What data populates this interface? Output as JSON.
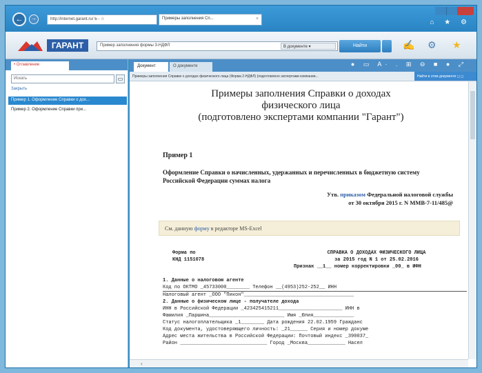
{
  "browser": {
    "back_icon": "back-arrow-icon",
    "address": "http://internet.garant.ru/ ᑲ - ☆",
    "tab_title": "Примеры заполнения Сп...",
    "tab_close": "×",
    "toolbar_icons": "⌂ ★ ⚙"
  },
  "garant": {
    "logo_text": "ГАРАНТ",
    "search_value": "Пример заполнения формы 3-НДФЛ",
    "search_scope": "В документе ▾",
    "find_label": "Найти",
    "icons": [
      "book-icon",
      "settings-icon",
      "star-icon"
    ]
  },
  "left_panel": {
    "tab_label": "• Оглавление",
    "search_placeholder": "Искать",
    "search_btn": "▭",
    "link_label": "Закрыть",
    "items": [
      {
        "label": "Пример 1. Оформление Справки о дох...",
        "selected": true
      },
      {
        "label": "Пример 2. Оформление Справки при...",
        "selected": false
      }
    ]
  },
  "doc": {
    "tab_active": "Документ",
    "tab_inactive": "О документе",
    "tab_icons": "● ▭ A· . ⊞ ⊖ ■ ● ⤢",
    "title_bar": "Примеры заполнения Справки о доходах физического лица (Форма 2-НДФЛ) (подготовлено экспертами компании...",
    "title_bar_right": "Найти в этом документе ◻ ◻",
    "heading_lines": [
      "Примеры заполнения Справки о доходах",
      "физического лица",
      "(подготовлено экспертами компании \"Гарант\")"
    ],
    "example_title": "Пример 1",
    "example_desc": "Оформление Справки о начисленных, удержанных и перечисленных в бюджетную систему Российской Федерации суммах налога",
    "approved_prefix": "Утв.",
    "approved_link": "приказом",
    "approved_rest": "Федеральной налоговой службы",
    "approved_line2": "от 30 октября 2015 г. N ММВ-7-11/485@",
    "excel_prefix": "См. данную",
    "excel_link": "форму",
    "excel_rest": "в редакторе MS-Excel",
    "form_code_lines": [
      "Форма по",
      "КНД 1151078"
    ],
    "form_right_lines": [
      "СПРАВКА О ДОХОДАХ ФИЗИЧЕСКОГО ЛИЦА",
      "за 2015 год N 1 от 25.02.2016",
      "Признак __1__ номер корректировки _00_ в ИФН"
    ],
    "section_lines": [
      {
        "bold": true,
        "text": "1. Данные о налоговом агенте"
      },
      {
        "bold": false,
        "text": "Код по ОКТМО _45733000________   Телефон __(4953)252-252__  ИНН"
      },
      {
        "bold": false,
        "text": "Налоговый агент _ООО \"Пикон\"______________________________________"
      },
      {
        "bold": true,
        "text": "2. Данные о физическом лице - получателе дохода"
      },
      {
        "bold": false,
        "text": "ИНН в Российской Федерации _423425415211______________________ ИНН в"
      },
      {
        "bold": false,
        "text": "Фамилия _Паршина__________________________ Имя _Юлия______________"
      },
      {
        "bold": false,
        "text": "Статус налогоплательщика _1________ Дата рождения 22.02.1959  Гражданс"
      },
      {
        "bold": false,
        "text": "Код документа, удостоверяющего личность: _21______  Серия и номер докуме"
      },
      {
        "bold": false,
        "text": "Адрес места жительства в Российской Федерации: Почтовый индекс _390037_"
      },
      {
        "bold": false,
        "text": "Район ______________________________ Город _Москва_____________ Насел"
      }
    ],
    "scroll_left": "‹",
    "scroll_right": "›"
  }
}
